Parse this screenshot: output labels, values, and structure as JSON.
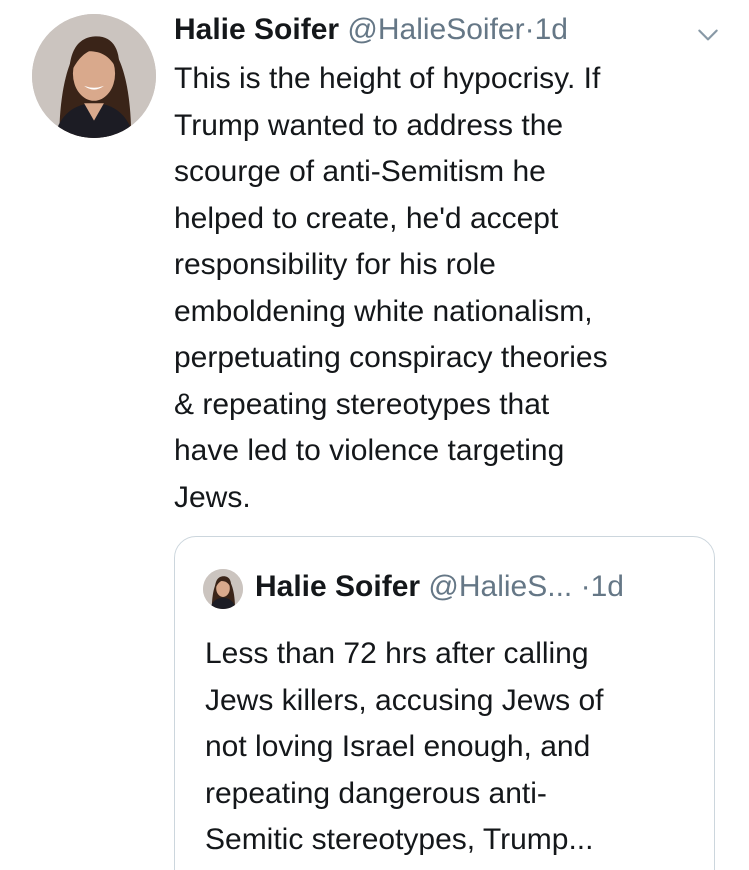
{
  "tweet": {
    "author": {
      "display_name": "Halie Soifer",
      "handle": "@HalieSoifer",
      "avatar_icon": "profile-photo"
    },
    "separator": "·",
    "timestamp": "1d",
    "menu_icon": "chevron-down-icon",
    "text_lines": [
      "This is the height of hypocrisy. If",
      "Trump wanted to address the",
      "scourge of anti-Semitism he",
      "helped to create, he'd accept",
      "responsibility for his role",
      "emboldening white nationalism,",
      "perpetuating conspiracy theories",
      "& repeating stereotypes that",
      "have led to violence targeting",
      "Jews."
    ]
  },
  "quoted_tweet": {
    "author": {
      "display_name": "Halie Soifer",
      "handle": "@HalieS...",
      "avatar_icon": "profile-photo"
    },
    "separator": "·",
    "timestamp": "1d",
    "text_lines": [
      "Less than 72 hrs after calling",
      "Jews killers, accusing Jews of",
      "not loving Israel enough, and",
      "repeating dangerous anti-",
      "Semitic stereotypes, Trump..."
    ]
  },
  "colors": {
    "text_primary": "#14171a",
    "text_secondary": "#657786",
    "border": "#ccd6dd",
    "background": "#ffffff"
  }
}
